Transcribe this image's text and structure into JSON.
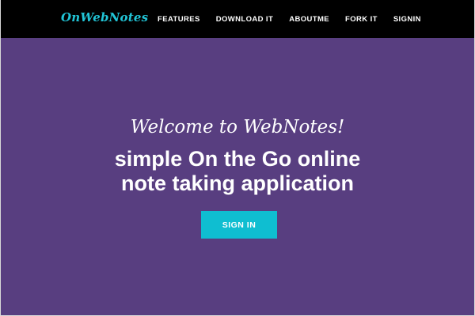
{
  "navbar": {
    "brand": "OnWebNotes",
    "links": [
      "FEATURES",
      "DOWNLOAD IT",
      "ABOUTME",
      "FORK IT",
      "SIGNIN"
    ]
  },
  "hero": {
    "welcome": "Welcome to WebNotes!",
    "tagline_line1": "simple On the Go online",
    "tagline_line2": "note taking application",
    "signin_button": "SIGN IN"
  },
  "colors": {
    "navbar_bg": "#000000",
    "brand": "#21c4d6",
    "hero_bg": "#583e80",
    "button_bg": "#0fbed1",
    "text": "#ffffff"
  }
}
